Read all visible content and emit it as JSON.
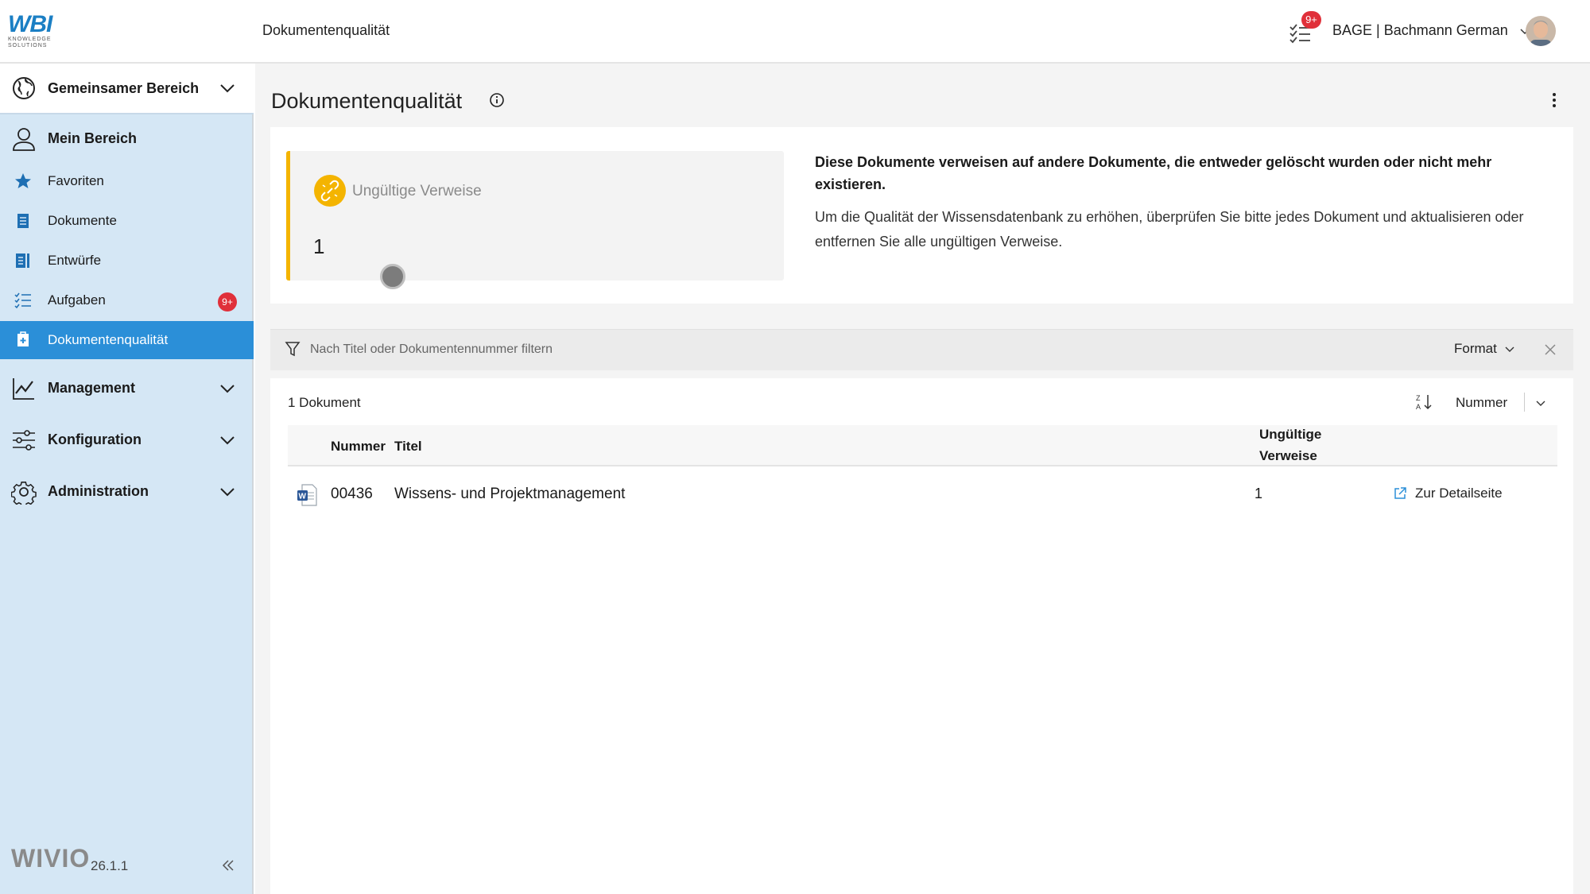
{
  "header": {
    "logo_main": "WBI",
    "logo_sub1": "KNOWLEDGE",
    "logo_sub2": "SOLUTIONS",
    "title": "Dokumentenqualität",
    "tasks_badge": "9+",
    "user_name": "BAGE | Bachmann German"
  },
  "sidebar": {
    "sections": [
      {
        "label": "Gemeinsamer Bereich",
        "icon": "globe-icon"
      },
      {
        "label": "Mein Bereich",
        "icon": "user-icon"
      },
      {
        "label": "Management",
        "icon": "chart-line-icon"
      },
      {
        "label": "Konfiguration",
        "icon": "sliders-icon"
      },
      {
        "label": "Administration",
        "icon": "gear-icon"
      }
    ],
    "items": [
      {
        "label": "Favoriten",
        "icon": "star-icon"
      },
      {
        "label": "Dokumente",
        "icon": "document-icon"
      },
      {
        "label": "Entwürfe",
        "icon": "drafts-icon"
      },
      {
        "label": "Aufgaben",
        "icon": "tasks-icon",
        "badge": "9+"
      },
      {
        "label": "Dokumentenqualität",
        "icon": "quality-icon",
        "active": true
      }
    ],
    "footer_brand": "WIVIO",
    "footer_version": "26.1.1"
  },
  "main": {
    "title": "Dokumentenqualität",
    "kpi": {
      "label": "Ungültige Verweise",
      "value": "1",
      "icon": "broken-link-icon"
    },
    "description_bold": "Diese Dokumente verweisen auf andere Dokumente, die entweder gelöscht wurden oder nicht mehr existieren.",
    "description_text": "Um die Qualität der Wissensdatenbank zu erhöhen, überprüfen Sie bitte jedes Dokument und aktualisieren oder entfernen Sie alle ungültigen Verweise.",
    "filter": {
      "placeholder": "Nach Titel oder Dokumentennummer filtern",
      "format_label": "Format"
    },
    "list": {
      "count": "1 Dokument",
      "sort_label": "Nummer",
      "columns": {
        "number": "Nummer",
        "title": "Titel",
        "invalid_refs_1": "Ungültige",
        "invalid_refs_2": "Verweise"
      },
      "rows": [
        {
          "number": "00436",
          "title": "Wissens- und Projektmanagement",
          "invalid_refs": "1",
          "link_label": "Zur Detailseite",
          "icon": "word-document-icon"
        }
      ]
    }
  },
  "colors": {
    "accent": "#2b8fd8",
    "sidebar_bg": "#d5e7f5",
    "kpi_accent": "#f4b400",
    "badge": "#e0303a"
  }
}
